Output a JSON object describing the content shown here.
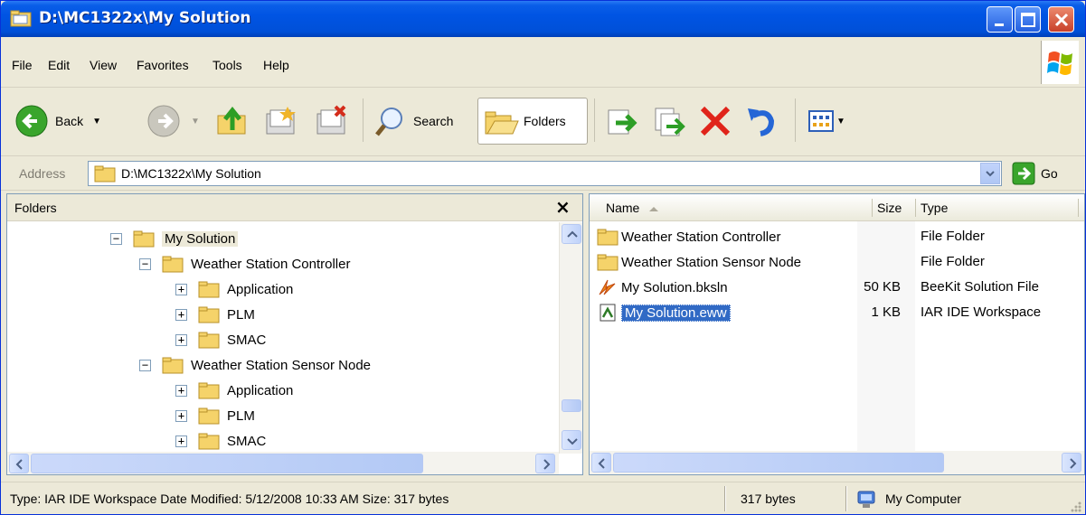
{
  "window": {
    "title": "D:\\MC1322x\\My Solution",
    "icons": {
      "app": "folder-window-icon",
      "minimize": "minimize-icon",
      "maximize": "maximize-icon",
      "close": "close-icon"
    }
  },
  "menu": {
    "items": [
      {
        "label": "File"
      },
      {
        "label": "Edit"
      },
      {
        "label": "View"
      },
      {
        "label": "Favorites"
      },
      {
        "label": "Tools"
      },
      {
        "label": "Help"
      }
    ]
  },
  "toolbar": {
    "back_label": "Back",
    "search_label": "Search",
    "folders_label": "Folders"
  },
  "address": {
    "label": "Address",
    "path": "D:\\MC1322x\\My Solution",
    "go_label": "Go"
  },
  "folders_pane": {
    "title": "Folders",
    "close_glyph": "×",
    "tree": [
      {
        "label": "My Solution",
        "expander": "−",
        "selected": true
      },
      {
        "label": "Weather Station Controller",
        "expander": "−"
      },
      {
        "label": "Application",
        "expander": "+"
      },
      {
        "label": "PLM",
        "expander": "+"
      },
      {
        "label": "SMAC",
        "expander": "+"
      },
      {
        "label": "Weather Station Sensor Node",
        "expander": "−"
      },
      {
        "label": "Application",
        "expander": "+"
      },
      {
        "label": "PLM",
        "expander": "+"
      },
      {
        "label": "SMAC",
        "expander": "+"
      }
    ]
  },
  "files_pane": {
    "columns": {
      "name": "Name",
      "size": "Size",
      "type": "Type"
    },
    "rows": [
      {
        "name": "Weather Station Controller",
        "size": "",
        "type": "File Folder",
        "icon": "folder-icon"
      },
      {
        "name": "Weather Station Sensor Node",
        "size": "",
        "type": "File Folder",
        "icon": "folder-icon"
      },
      {
        "name": "My Solution.bksln",
        "size": "50 KB",
        "type": "BeeKit Solution File",
        "icon": "beekit-file-icon"
      },
      {
        "name": "My Solution.eww",
        "size": "1 KB",
        "type": "IAR IDE Workspace",
        "icon": "iar-workspace-icon",
        "selected": true
      }
    ]
  },
  "status": {
    "details": "Type: IAR IDE Workspace Date Modified: 5/12/2008 10:33 AM Size: 317 bytes",
    "size": "317 bytes",
    "location": "My Computer"
  },
  "colors": {
    "titlebar": "#0054e3",
    "selection": "#316ac5",
    "window_bg": "#ece9d8"
  }
}
